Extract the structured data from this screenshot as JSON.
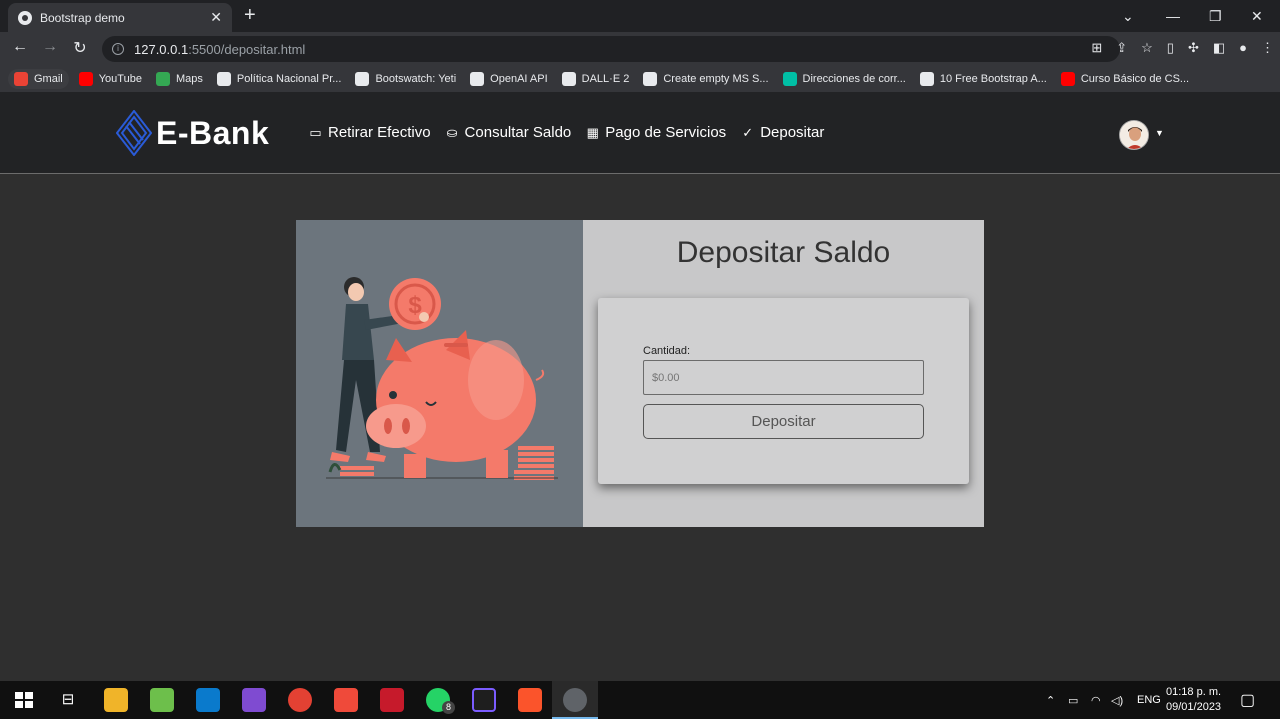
{
  "browser": {
    "tab_title": "Bootstrap demo",
    "url_host": "127.0.0.1",
    "url_rest": ":5500/depositar.html",
    "bookmarks": [
      {
        "label": "Gmail",
        "color": "#ea4335"
      },
      {
        "label": "YouTube",
        "color": "#ff0000"
      },
      {
        "label": "Maps",
        "color": "#34a853"
      },
      {
        "label": "Política Nacional Pr...",
        "color": "#e8eaed"
      },
      {
        "label": "Bootswatch: Yeti",
        "color": "#e8eaed"
      },
      {
        "label": "OpenAI API",
        "color": "#e8eaed"
      },
      {
        "label": "DALL·E 2",
        "color": "#e8eaed"
      },
      {
        "label": "Create empty MS S...",
        "color": "#e8eaed"
      },
      {
        "label": "Direcciones de corr...",
        "color": "#00bfa5"
      },
      {
        "label": "10 Free Bootstrap A...",
        "color": "#e8eaed"
      },
      {
        "label": "Curso Básico de CS...",
        "color": "#ff0000"
      }
    ]
  },
  "navbar": {
    "brand": "E-Bank",
    "links": [
      {
        "label": "Retirar Efectivo",
        "icon": "cash-icon"
      },
      {
        "label": "Consultar Saldo",
        "icon": "coins-icon"
      },
      {
        "label": "Pago de Servicios",
        "icon": "calculator-icon"
      },
      {
        "label": "Depositar",
        "icon": "check-circle-icon"
      }
    ]
  },
  "main": {
    "title": "Depositar Saldo",
    "amount_label": "Cantidad:",
    "amount_placeholder": "$0.00",
    "submit_label": "Depositar"
  },
  "taskbar": {
    "language": "ENG",
    "time": "01:18 p. m.",
    "date": "09/01/2023",
    "whatsapp_badge": "8"
  },
  "colors": {
    "navbar_bg": "#222325",
    "page_bg": "#2f2f2f",
    "card_left_bg": "#6c757d",
    "card_right_bg": "#c8c8c9",
    "piggy": "#f47a6a"
  }
}
